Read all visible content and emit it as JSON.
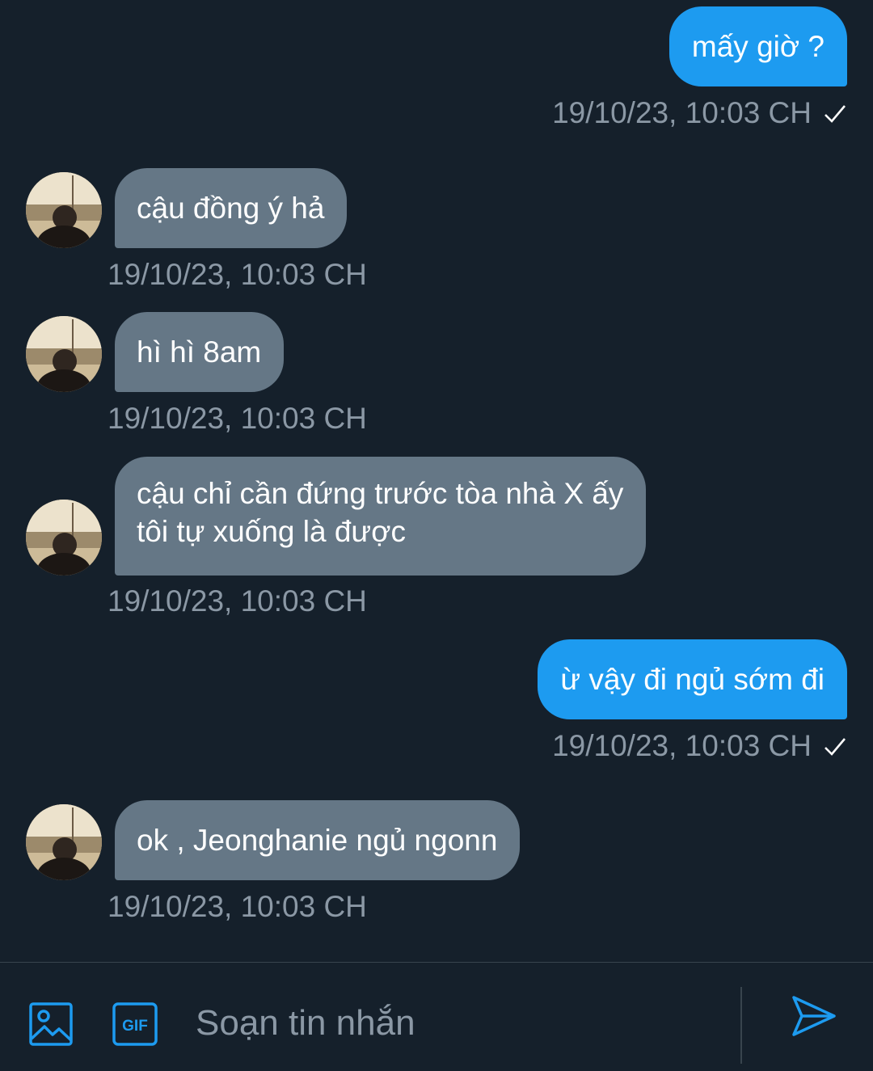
{
  "messages": [
    {
      "direction": "outgoing",
      "text": "mấy giờ ?",
      "timestamp": "19/10/23, 10:03 CH",
      "read_check": "✓"
    },
    {
      "direction": "incoming",
      "text": "cậu đồng ý hả",
      "timestamp": "19/10/23, 10:03 CH"
    },
    {
      "direction": "incoming",
      "text": "hì hì 8am",
      "timestamp": "19/10/23, 10:03 CH"
    },
    {
      "direction": "incoming",
      "lines": [
        "cậu chỉ cần đứng trước tòa nhà X ấy",
        "tôi tự xuống là được"
      ],
      "timestamp": "19/10/23, 10:03 CH"
    },
    {
      "direction": "outgoing",
      "text": "ừ vậy đi ngủ sớm đi",
      "timestamp": "19/10/23, 10:03 CH",
      "read_check": "✓"
    },
    {
      "direction": "incoming",
      "text": "ok , Jeonghanie ngủ ngonn",
      "timestamp": "19/10/23, 10:03 CH"
    }
  ],
  "composer": {
    "placeholder": "Soạn tin nhắn",
    "gif_label": "GIF",
    "image_icon": "image-icon",
    "send_icon": "send-icon"
  },
  "colors": {
    "background": "#15202b",
    "outgoing_bubble": "#1d9bf0",
    "incoming_bubble": "#657786",
    "timestamp": "#8b98a5",
    "accent": "#1d9bf0"
  }
}
